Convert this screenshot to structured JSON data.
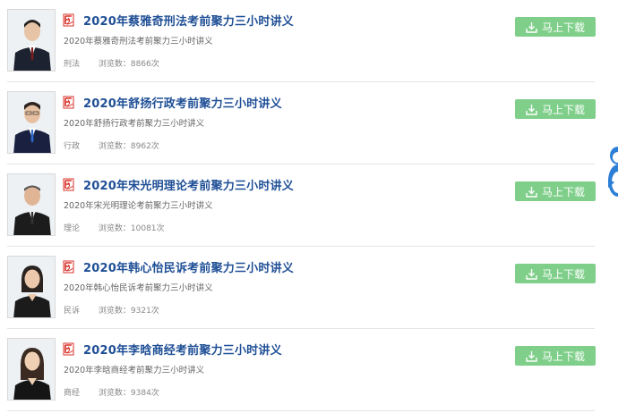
{
  "download_label": "马上下载",
  "items": [
    {
      "title": "2020年蔡雅奇刑法考前聚力三小时讲义",
      "desc": "2020年蔡雅奇刑法考前聚力三小时讲义",
      "category": "刑法",
      "views_label": "浏览数：",
      "views_value": "8866次"
    },
    {
      "title": "2020年舒扬行政考前聚力三小时讲义",
      "desc": "2020年舒扬行政考前聚力三小时讲义",
      "category": "行政",
      "views_label": "浏览数：",
      "views_value": "8962次"
    },
    {
      "title": "2020年宋光明理论考前聚力三小时讲义",
      "desc": "2020年宋光明理论考前聚力三小时讲义",
      "category": "理论",
      "views_label": "浏览数：",
      "views_value": "10081次"
    },
    {
      "title": "2020年韩心怡民诉考前聚力三小时讲义",
      "desc": "2020年韩心怡民诉考前聚力三小时讲义",
      "category": "民诉",
      "views_label": "浏览数：",
      "views_value": "9321次"
    },
    {
      "title": "2020年李晗商经考前聚力三小时讲义",
      "desc": "2020年李晗商经考前聚力三小时讲义",
      "category": "商经",
      "views_label": "浏览数：",
      "views_value": "9384次"
    }
  ],
  "colors": {
    "title": "#1f4f96",
    "button": "#7fcf8a",
    "pdf_icon": "#d9322a"
  },
  "icons": {
    "file": "pdf-icon",
    "download": "download-icon",
    "mascot": "mascot-icon"
  }
}
